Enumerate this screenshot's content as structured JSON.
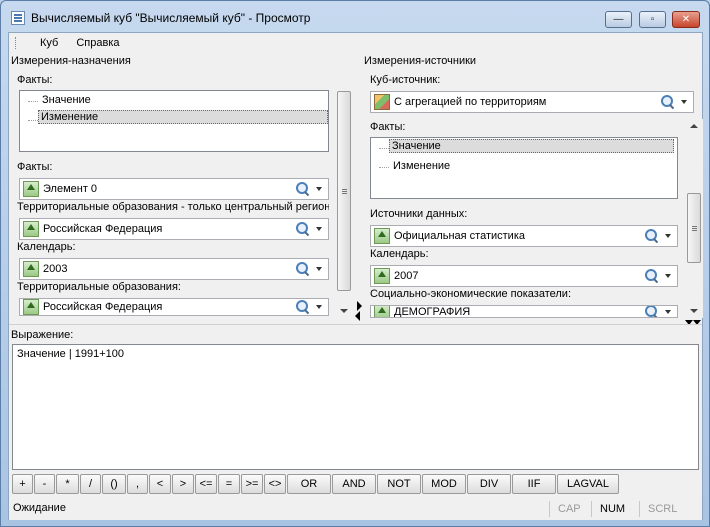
{
  "window": {
    "title": "Вычисляемый куб \"Вычисляемый куб\" - Просмотр",
    "buttons": {
      "minimize": "—",
      "maximize": "▫",
      "close": "✕"
    }
  },
  "menu": {
    "items": [
      "Куб",
      "Справка"
    ]
  },
  "left": {
    "section_title": "Измерения-назначения",
    "facts_list_label": "Факты:",
    "facts_list": [
      {
        "label": "Значение",
        "selected": false
      },
      {
        "label": "Изменение",
        "selected": true
      }
    ],
    "dimensions": [
      {
        "label": "Факты:",
        "value": "Элемент 0"
      },
      {
        "label": "Территориальные образования - только центральный регион",
        "value": "Российская Федерация"
      },
      {
        "label": "Календарь:",
        "value": "2003"
      },
      {
        "label": "Территориальные образования:",
        "value": "Российская Федерация"
      }
    ]
  },
  "right": {
    "section_title": "Измерения-источники",
    "cube_label": "Куб-источник:",
    "cube_value": "С агрегацией по территориям",
    "facts_list_label": "Факты:",
    "facts_list": [
      {
        "label": "Значение",
        "selected": true
      },
      {
        "label": "Изменение",
        "selected": false
      }
    ],
    "dimensions": [
      {
        "label": "Источники данных:",
        "value": "Официальная статистика"
      },
      {
        "label": "Календарь:",
        "value": "2007"
      },
      {
        "label": "Социально-экономические показатели:",
        "value": "ДЕМОГРАФИЯ"
      }
    ]
  },
  "expression": {
    "label": "Выражение:",
    "text": "Значение | 1991+100"
  },
  "operators": [
    "+",
    "-",
    "*",
    "/",
    "()",
    ",",
    "<",
    ">",
    "<=",
    "=",
    ">=",
    "<>",
    "OR",
    "AND",
    "NOT",
    "MOD",
    "DIV",
    "IIF",
    "LAGVAL"
  ],
  "status": {
    "text": "Ожидание",
    "indicators": [
      {
        "label": "CAP",
        "active": false
      },
      {
        "label": "NUM",
        "active": true
      },
      {
        "label": "SCRL",
        "active": false
      }
    ]
  },
  "colors": {
    "accent": "#4b7fb8",
    "selection": "#dcdcdc",
    "titlebar": "#b9d1ea"
  }
}
